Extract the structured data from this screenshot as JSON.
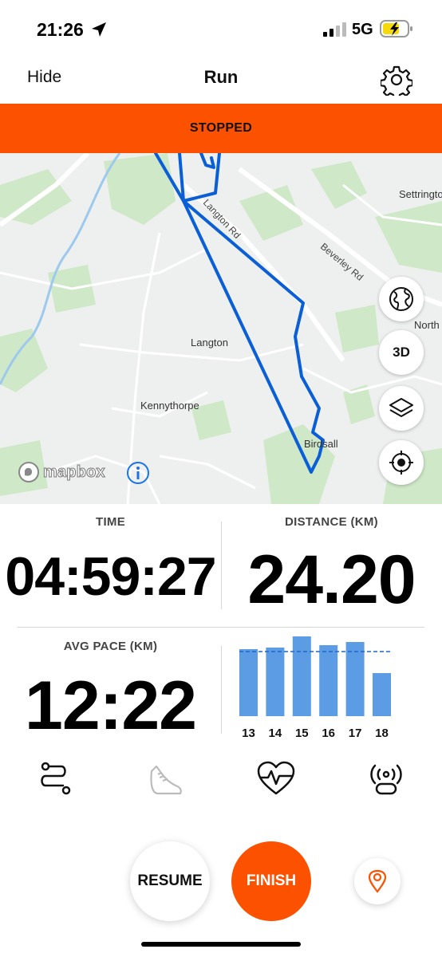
{
  "status_bar": {
    "time": "21:26",
    "network": "5G",
    "icons": [
      "location-arrow-icon",
      "signal-bars-icon",
      "battery-charging-icon"
    ]
  },
  "nav": {
    "hide_label": "Hide",
    "title": "Run",
    "settings_icon": "gear-icon"
  },
  "banner": {
    "text": "STOPPED",
    "color": "#fc5200"
  },
  "map": {
    "places": {
      "settrington": "Settringto",
      "north": "North",
      "langton": "Langton",
      "kennythorpe": "Kennythorpe",
      "birdsall": "Birdsall"
    },
    "roads": {
      "langton_rd": "Langton Rd",
      "beverley_rd": "Beverley Rd"
    },
    "route_color": "#0a5fd6",
    "controls": {
      "globe_icon": "globe-icon",
      "three_d_label": "3D",
      "layers_icon": "layers-icon",
      "locate_icon": "crosshair-icon"
    },
    "attribution": "mapbox",
    "info_icon": "info-icon"
  },
  "stats": {
    "time_label": "TIME",
    "time_value": "04:59:27",
    "distance_label": "DISTANCE (KM)",
    "distance_value": "24.20",
    "pace_label": "AVG PACE (KM)",
    "pace_value": "12:22"
  },
  "chart_data": {
    "type": "bar",
    "categories": [
      "13",
      "14",
      "15",
      "16",
      "17",
      "18"
    ],
    "values": [
      0.84,
      0.86,
      1.0,
      0.89,
      0.93,
      0.54
    ],
    "reference_line": 0.81,
    "ylim": [
      0,
      1
    ],
    "bar_color": "#5b9ce4",
    "reference_color": "#1f66c9"
  },
  "tabs": [
    {
      "icon": "route-icon",
      "active": true
    },
    {
      "icon": "shoe-icon",
      "active": false
    },
    {
      "icon": "heart-rate-icon",
      "active": false
    },
    {
      "icon": "sensor-icon",
      "active": false
    }
  ],
  "actions": {
    "resume_label": "RESUME",
    "finish_label": "FINISH",
    "pin_icon": "location-pin-icon",
    "accent": "#fc5200"
  }
}
